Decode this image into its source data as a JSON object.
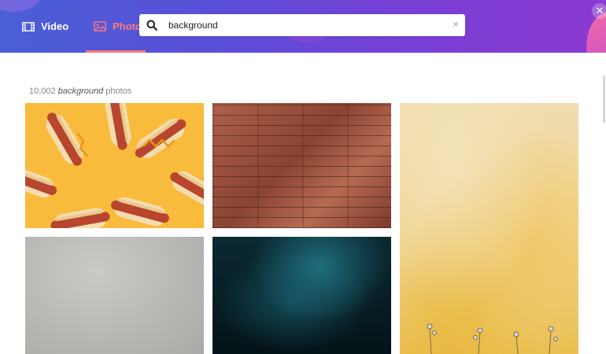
{
  "header": {
    "tabs": [
      {
        "label": "Video",
        "icon": "film-icon",
        "active": false
      },
      {
        "label": "Photo",
        "icon": "image-icon",
        "active": true
      }
    ],
    "search": {
      "value": "background",
      "clear_symbol": "×"
    },
    "close_symbol": "✕",
    "colors": {
      "accent": "#ff7a7a",
      "gradient_start": "#4a5fd6",
      "gradient_end": "#8b3ad0"
    }
  },
  "results": {
    "count": "10,002",
    "query": "background",
    "suffix": "photos",
    "photos": [
      {
        "name": "hotdogs-on-yellow"
      },
      {
        "name": "reddish-wood-planks"
      },
      {
        "name": "yellow-textured-wall"
      },
      {
        "name": "grey-concrete"
      },
      {
        "name": "dark-teal-smoke"
      }
    ]
  }
}
